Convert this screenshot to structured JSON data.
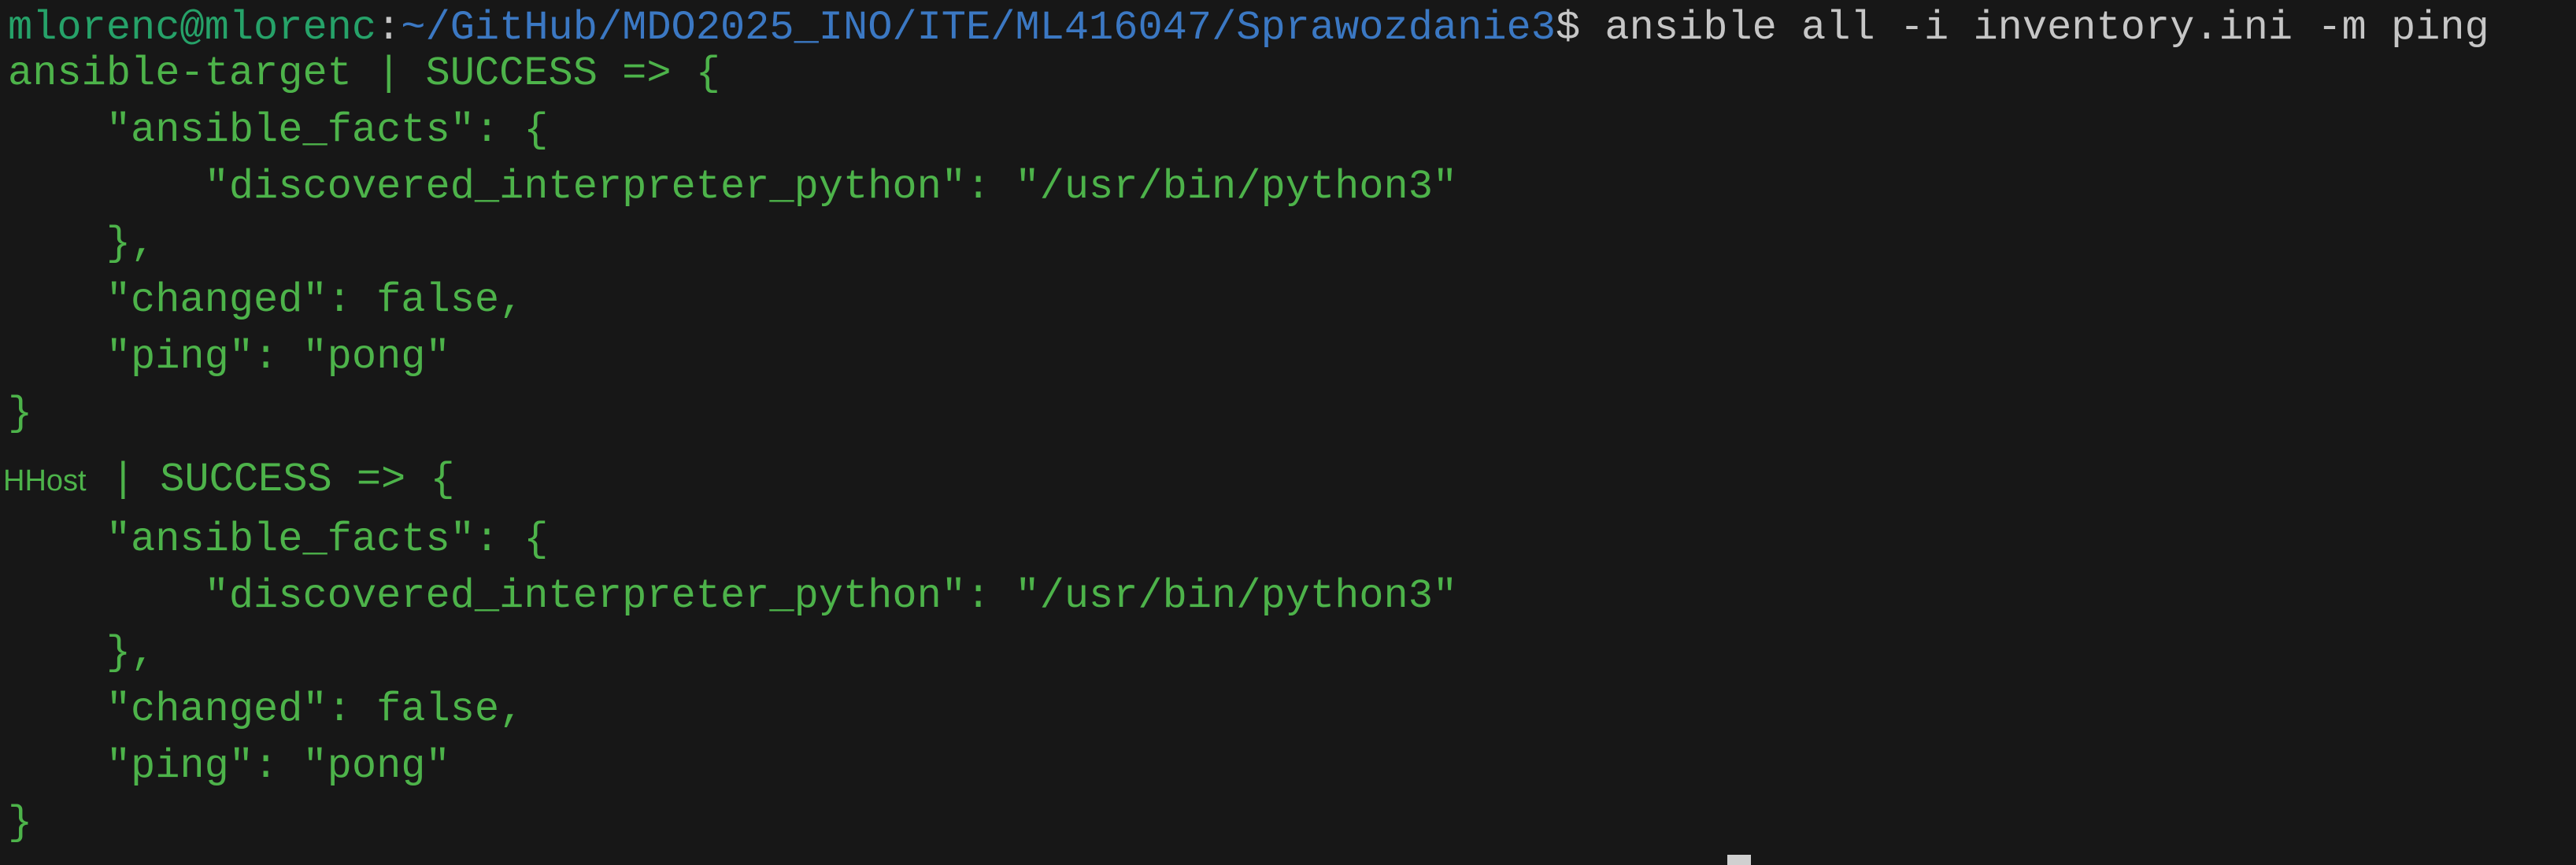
{
  "prompt": {
    "userhost": "mlorenc@mlorenc",
    "separator": ":",
    "path": "~/GitHub/MDO2025_INO/ITE/ML416047/Sprawozdanie3",
    "symbol": "$",
    "command": "ansible all -i inventory.ini -m ping"
  },
  "results": [
    {
      "host": "ansible-target",
      "status": "| SUCCESS => {",
      "lines": [
        "    \"ansible_facts\": {",
        "        \"discovered_interpreter_python\": \"/usr/bin/python3\"",
        "    },",
        "    \"changed\": false,",
        "    \"ping\": \"pong\"",
        "}"
      ]
    },
    {
      "host": "HHost",
      "status": "| SUCCESS => {",
      "lines": [
        "    \"ansible_facts\": {",
        "        \"discovered_interpreter_python\": \"/usr/bin/python3\"",
        "    },",
        "    \"changed\": false,",
        "    \"ping\": \"pong\"",
        "}"
      ]
    }
  ],
  "colors": {
    "background": "#171717",
    "success": "#4db34a",
    "prompt_user": "#26a269",
    "prompt_path": "#3b78c3",
    "text": "#c6c6c6"
  }
}
